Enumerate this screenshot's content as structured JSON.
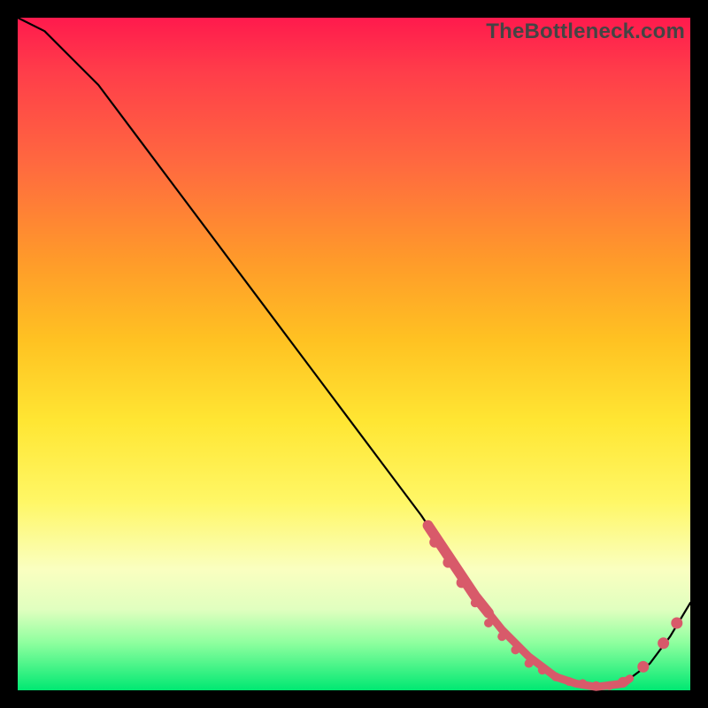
{
  "branding": "TheBottleneck.com",
  "colors": {
    "curve": "#000000",
    "marker": "#d85a6a"
  },
  "chart_data": {
    "type": "line",
    "title": "",
    "xlabel": "",
    "ylabel": "",
    "xlim": [
      0,
      100
    ],
    "ylim": [
      0,
      100
    ],
    "grid": false,
    "x": [
      0,
      4,
      8,
      12,
      18,
      24,
      30,
      36,
      42,
      48,
      54,
      60,
      64,
      68,
      72,
      76,
      80,
      83,
      86,
      90,
      94,
      97,
      100
    ],
    "values": [
      100,
      98,
      94,
      90,
      82,
      74,
      66,
      58,
      50,
      42,
      34,
      26,
      20,
      14,
      9,
      5,
      2,
      1,
      0.5,
      1,
      4,
      8,
      13
    ],
    "markers_x": [
      62,
      64,
      66,
      68,
      70,
      72,
      74,
      76,
      78,
      80,
      82,
      84,
      86,
      88,
      90,
      93,
      96
    ],
    "markers_y": [
      22,
      19,
      16,
      13,
      10,
      8,
      6,
      4,
      3,
      2,
      1.3,
      1,
      0.7,
      0.7,
      1.2,
      3.5,
      7
    ],
    "annotations": []
  }
}
